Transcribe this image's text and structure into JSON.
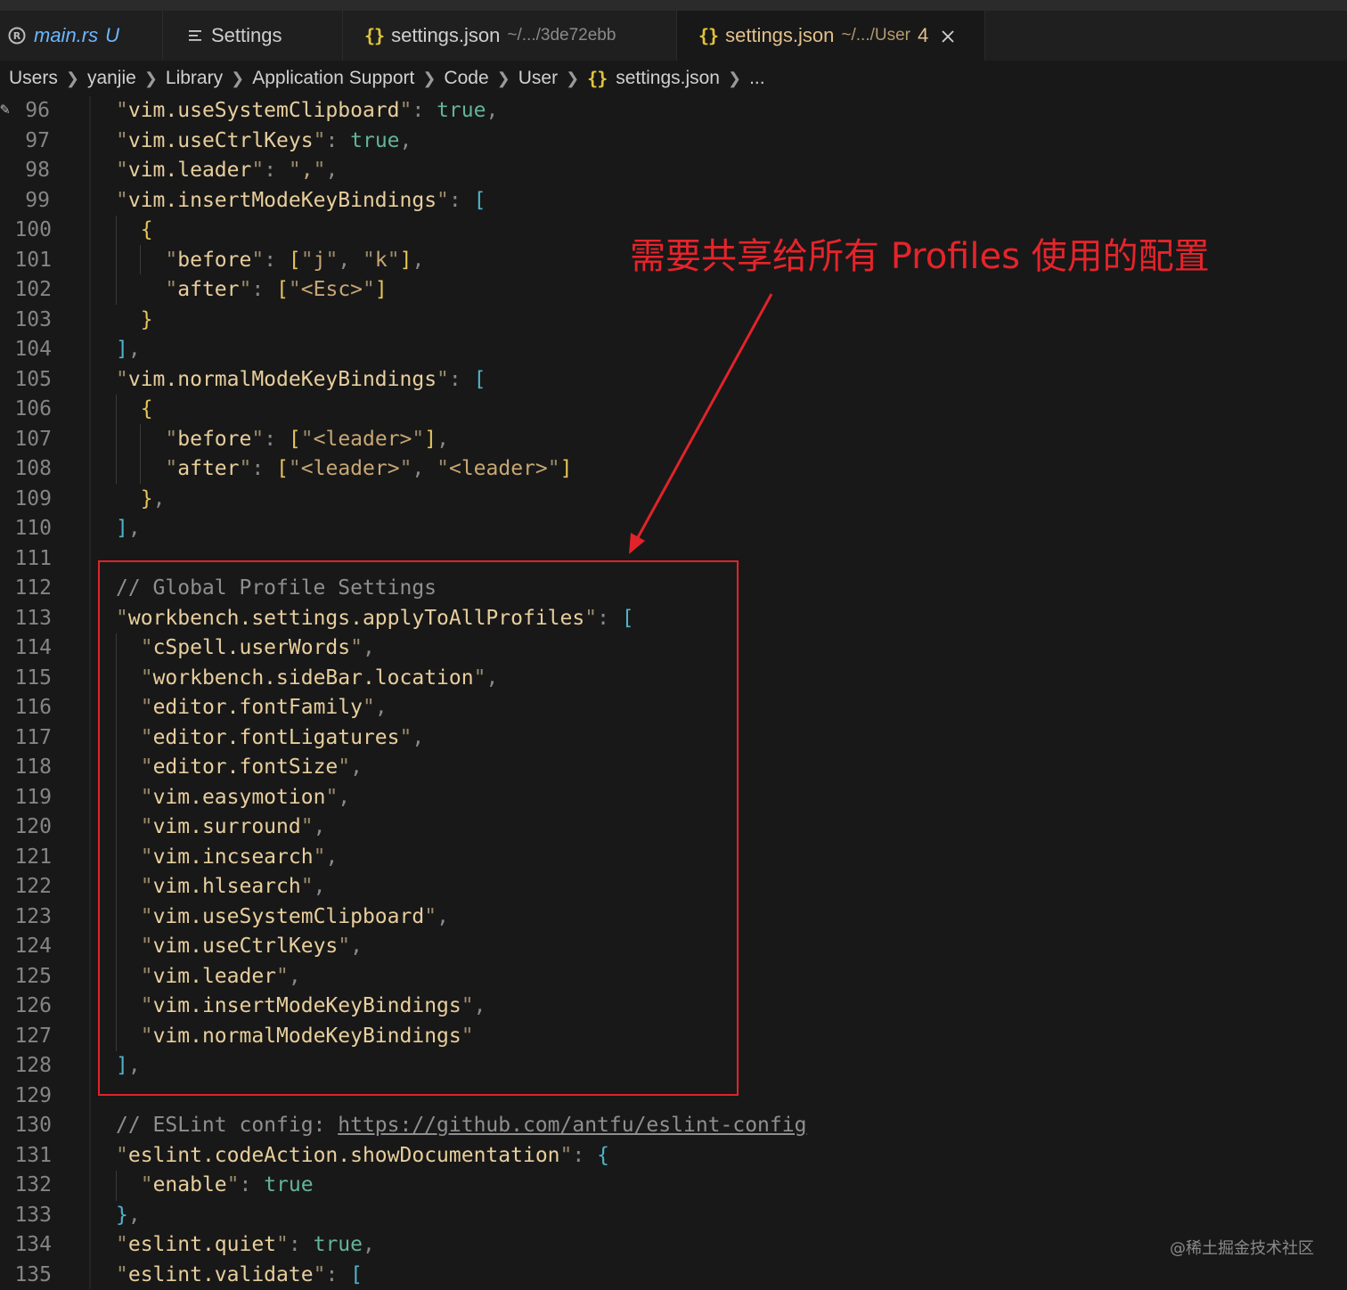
{
  "tabs": [
    {
      "icon": "rust-icon",
      "label": "main.rs",
      "description": "",
      "badge": "U",
      "active": false
    },
    {
      "icon": "settings-list-icon",
      "label": "Settings",
      "description": "",
      "badge": "",
      "active": false
    },
    {
      "icon": "json-icon",
      "label": "settings.json",
      "description": "~/.../3de72ebb",
      "badge": "",
      "active": false
    },
    {
      "icon": "json-icon",
      "label": "settings.json",
      "description": "~/.../User",
      "badge": "4",
      "active": true
    }
  ],
  "breadcrumb": [
    "Users",
    "yanjie",
    "Library",
    "Application Support",
    "Code",
    "User",
    "settings.json",
    "..."
  ],
  "editor": {
    "lines": [
      {
        "n": "96"
      },
      {
        "n": "97"
      },
      {
        "n": "98"
      },
      {
        "n": "99"
      },
      {
        "n": "100"
      },
      {
        "n": "101"
      },
      {
        "n": "102"
      },
      {
        "n": "103"
      },
      {
        "n": "104"
      },
      {
        "n": "105"
      },
      {
        "n": "106"
      },
      {
        "n": "107"
      },
      {
        "n": "108"
      },
      {
        "n": "109"
      },
      {
        "n": "110"
      },
      {
        "n": "111"
      },
      {
        "n": "112"
      },
      {
        "n": "113"
      },
      {
        "n": "114"
      },
      {
        "n": "115"
      },
      {
        "n": "116"
      },
      {
        "n": "117"
      },
      {
        "n": "118"
      },
      {
        "n": "119"
      },
      {
        "n": "120"
      },
      {
        "n": "121"
      },
      {
        "n": "122"
      },
      {
        "n": "123"
      },
      {
        "n": "124"
      },
      {
        "n": "125"
      },
      {
        "n": "126"
      },
      {
        "n": "127"
      },
      {
        "n": "128"
      },
      {
        "n": "129"
      },
      {
        "n": "130"
      },
      {
        "n": "131"
      },
      {
        "n": "132"
      },
      {
        "n": "133"
      },
      {
        "n": "134"
      },
      {
        "n": "135"
      }
    ],
    "code": {
      "k96": "vim.useSystemClipboard",
      "v96": "true",
      "k97": "vim.useCtrlKeys",
      "v97": "true",
      "k98": "vim.leader",
      "v98": ",",
      "k99": "vim.insertModeKeyBindings",
      "k101": "before",
      "v101a": "j",
      "v101b": "k",
      "k102": "after",
      "v102": "<Esc>",
      "k105": "vim.normalModeKeyBindings",
      "k107": "before",
      "v107": "<leader>",
      "k108": "after",
      "v108a": "<leader>",
      "v108b": "<leader>",
      "c112": "// Global Profile Settings",
      "k113": "workbench.settings.applyToAllProfiles",
      "s114": "cSpell.userWords",
      "s115": "workbench.sideBar.location",
      "s116": "editor.fontFamily",
      "s117": "editor.fontLigatures",
      "s118": "editor.fontSize",
      "s119": "vim.easymotion",
      "s120": "vim.surround",
      "s121": "vim.incsearch",
      "s122": "vim.hlsearch",
      "s123": "vim.useSystemClipboard",
      "s124": "vim.useCtrlKeys",
      "s125": "vim.leader",
      "s126": "vim.insertModeKeyBindings",
      "s127": "vim.normalModeKeyBindings",
      "c130": "// ESLint config: ",
      "u130": "https://github.com/antfu/eslint-config",
      "k131": "eslint.codeAction.showDocumentation",
      "k132": "enable",
      "v132": "true",
      "k134": "eslint.quiet",
      "v134": "true",
      "k135": "eslint.validate"
    }
  },
  "annotation": {
    "text": "需要共享给所有 Profiles 使用的配置",
    "color": "#e6242b"
  },
  "watermark": "@稀土掘金技术社区",
  "colors": {
    "background": "#181818",
    "accent_highlight": "#e0242a",
    "json_icon": "#e2c33b",
    "badge": "#e2c08d"
  }
}
